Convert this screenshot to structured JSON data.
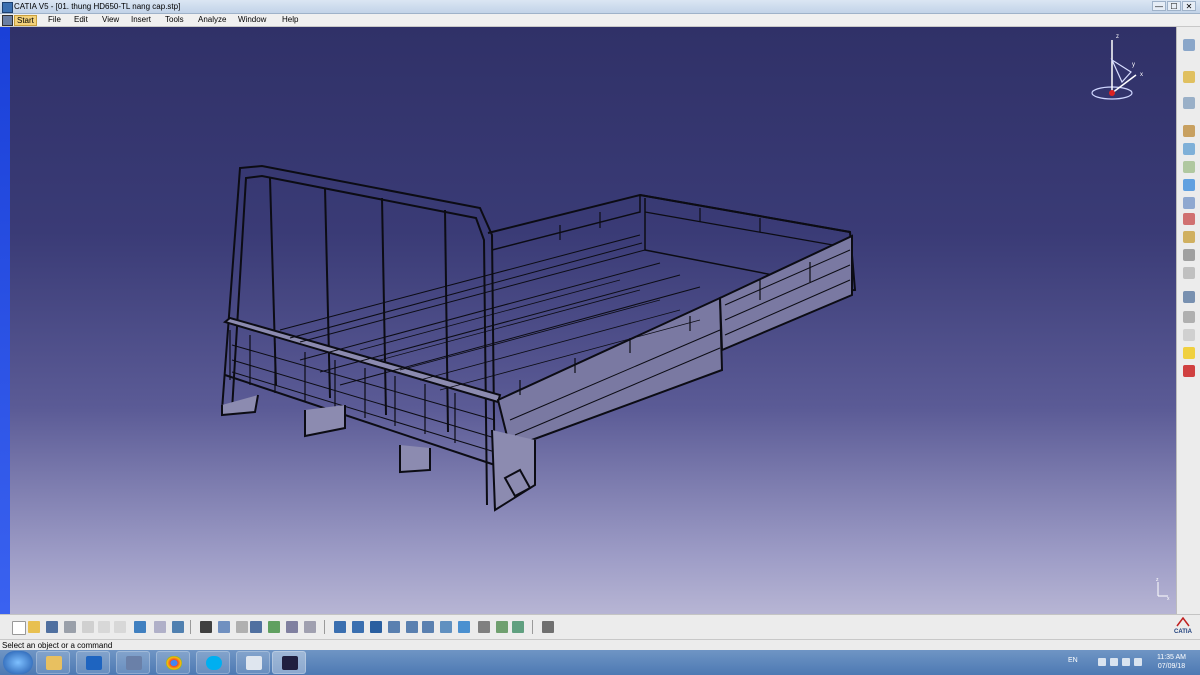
{
  "window": {
    "title": "CATIA V5 - [01. thung HD650-TL nang cap.stp]",
    "minimize_glyph": "—",
    "maximize_glyph": "☐",
    "close_glyph": "✕"
  },
  "menu": {
    "items": [
      "Start",
      "File",
      "Edit",
      "View",
      "Insert",
      "Tools",
      "Analyze",
      "Window",
      "Help"
    ]
  },
  "compass": {
    "z_label": "z",
    "x_label": "x",
    "y_label": "y"
  },
  "mini_axis": {
    "z_label": "z",
    "x_label": "x"
  },
  "status": {
    "message": "Select an object or a command"
  },
  "logo": {
    "text": "CATIA"
  },
  "taskbar": {
    "language": "EN",
    "time": "11:35 AM",
    "date": "07/09/18"
  },
  "colors": {
    "viewport_top": "#303168",
    "viewport_bottom": "#b7b5d4",
    "left_bar": "#2a50e4",
    "model_stroke": "#0c0c14",
    "model_fill": "#8c8bb0"
  },
  "toolbar_icons": [
    "new-icon",
    "open-icon",
    "save-icon",
    "print-icon",
    "cut-icon",
    "copy-icon",
    "paste-icon",
    "undo-icon",
    "redo-icon",
    "whats-this-icon",
    "formula-icon",
    "comment-icon",
    "bom-icon",
    "catalog-icon",
    "tree-icon",
    "measure-icon",
    "hide-icon",
    "fly-mode-icon",
    "fit-all-icon",
    "pan-icon",
    "rotate-icon",
    "zoom-in-icon",
    "zoom-out-icon",
    "normal-view-icon",
    "iso-view-icon",
    "render-style-icon",
    "hide-show-icon",
    "swap-space-icon",
    "macro-icon"
  ],
  "right_toolbar_icons": [
    "workbench-icon",
    "select-icon",
    "snap-icon",
    "product-icon",
    "component-icon",
    "part-icon",
    "existing-component-icon",
    "replace-icon",
    "graph-tree-icon",
    "generate-numbering-icon",
    "multi-instantiation-icon",
    "constraint-icon",
    "fix-icon",
    "manipulate-icon",
    "update-icon",
    "clash-icon"
  ]
}
